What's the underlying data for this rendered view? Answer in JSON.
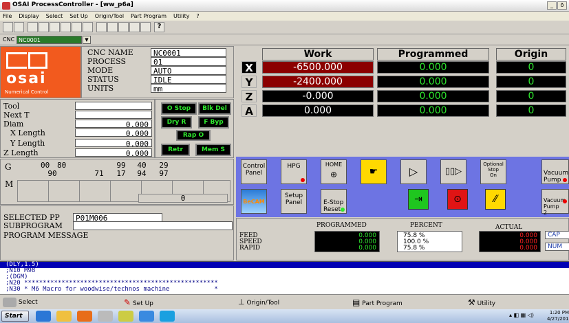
{
  "window": {
    "title": "OSAI ProcessController - [ww_p6a]",
    "min": "_",
    "restore": "ð"
  },
  "menu": [
    "File",
    "Display",
    "Select",
    "Set Up",
    "Origin/Tool",
    "Part Program",
    "Utility",
    "?"
  ],
  "cnc_bar": {
    "label": "CNC",
    "value": "NC0001"
  },
  "info": {
    "cnc_name_label": "CNC NAME",
    "cnc_name": "NC0001",
    "process_label": "PROCESS",
    "process": "01",
    "mode_label": "MODE",
    "mode": "AUTO",
    "status_label": "STATUS",
    "status": "IDLE",
    "units_label": "UNITS",
    "units": "mm",
    "logo": "osai",
    "logo_sub": "Numerical Control"
  },
  "axes": {
    "headers": {
      "work": "Work",
      "programmed": "Programmed",
      "origin": "Origin"
    },
    "rows": [
      {
        "axis": "X",
        "work": "-6500.000",
        "programmed": "0.000",
        "origin": "0"
      },
      {
        "axis": "Y",
        "work": "-2400.000",
        "programmed": "0.000",
        "origin": "0"
      },
      {
        "axis": "Z",
        "work": "-0.000",
        "programmed": "0.000",
        "origin": "0"
      },
      {
        "axis": "A",
        "work": "0.000",
        "programmed": "0.000",
        "origin": "0"
      }
    ]
  },
  "tool": {
    "tool_label": "Tool",
    "tool": "",
    "next_label": "Next T",
    "next": "",
    "diam_label": "Diam",
    "diam": "0.000",
    "xlen_label": "X Length",
    "xlen": "0.000",
    "ylen_label": "Y Length",
    "ylen": "0.000",
    "zlen_label": "Z Length",
    "zlen": "0.000"
  },
  "buttons": {
    "ostop": "O Stop",
    "blkdel": "Blk Del",
    "dryr": "Dry R",
    "fbyp": "F Byp",
    "rapo": "Rap O",
    "retr": "Retr",
    "mems": "Mem S"
  },
  "gcodes": {
    "label": "G",
    "row1": [
      "00",
      "80",
      "",
      "99",
      "40",
      "29",
      ""
    ],
    "row2": [
      "90",
      "",
      "71",
      "17",
      "94",
      "97",
      ""
    ],
    "m_label": "M",
    "zero": "0"
  },
  "program": {
    "selected_label": "SELECTED PP",
    "selected": "P01M006",
    "sub_label": "SUBPROGRAM",
    "sub": "",
    "msg_label": "PROGRAM MESSAGE"
  },
  "controls": {
    "control_panel": "Control\nPanel",
    "hpg": "HPG",
    "home": "HOME",
    "optional_stop": "Optional\nStop\nOn",
    "vacuum_pump": "Vacuum\nPump",
    "setup_panel": "Setup\nPanel",
    "estop_reset": "E-Stop\nReset",
    "vacuum_pump2": "Vacuum\nPump\n2",
    "becam": "BeCAM"
  },
  "feed": {
    "programmed_label": "PROGRAMMED",
    "percent_label": "PERCENT",
    "actual_label": "ACTUAL",
    "rows": [
      {
        "label": "FEED",
        "programmed": "0.000",
        "percent": "75.8 %",
        "actual": "0.000"
      },
      {
        "label": "SPEED",
        "programmed": "0.000",
        "percent": "100.0 %",
        "actual": "0.000"
      },
      {
        "label": "RAPID",
        "programmed": "0.000",
        "percent": "75.8 %",
        "actual": "0.000"
      }
    ],
    "cap": "CAP",
    "num": "NUM"
  },
  "code_lines": [
    "(DLY,1.5)",
    ";N10 M98",
    ";(DGM)",
    ";N20 ****************************************************",
    ";N30 * M6 Macro for woodwise/technos machine            *"
  ],
  "bottom": {
    "select": "Select",
    "setup": "Set Up",
    "origin": "Origin/Tool",
    "part": "Part Program",
    "utility": "Utility"
  },
  "taskbar": {
    "start": "Start",
    "time": "1:20 PM",
    "date": "4/27/2017"
  }
}
